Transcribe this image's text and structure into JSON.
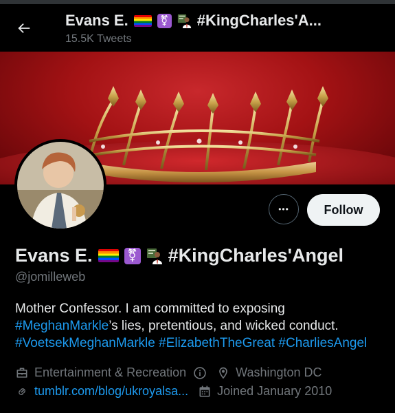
{
  "header": {
    "name": "Evans E.",
    "name_suffix": "#KingCharles'A...",
    "tweet_count": "15.5K Tweets"
  },
  "profile": {
    "display_name": "Evans E.",
    "name_hashtag": "#KingCharles'Angel",
    "handle": "@jomilleweb",
    "bio_line1": "Mother Confessor. I am committed to exposing",
    "bio_tag1": "#MeghanMarkle",
    "bio_line2_rest": "’s lies, pretentious, and wicked conduct.",
    "bio_tag2": "#VoetsekMeghanMarkle",
    "bio_tag3": "#ElizabethTheGreat",
    "bio_tag4": "#CharliesAngel",
    "category": "Entertainment & Recreation",
    "location": "Washington DC",
    "website": "tumblr.com/blog/ukroyalsa...",
    "joined": "Joined January 2010"
  },
  "actions": {
    "follow_label": "Follow",
    "more_label": "•••"
  },
  "icons": {
    "back": "arrow-left-icon",
    "category": "briefcase-icon",
    "info": "info-icon",
    "location": "location-pin-icon",
    "link": "link-icon",
    "calendar": "calendar-icon"
  },
  "colors": {
    "accent": "#1d9bf0",
    "banner": "#a31214"
  }
}
